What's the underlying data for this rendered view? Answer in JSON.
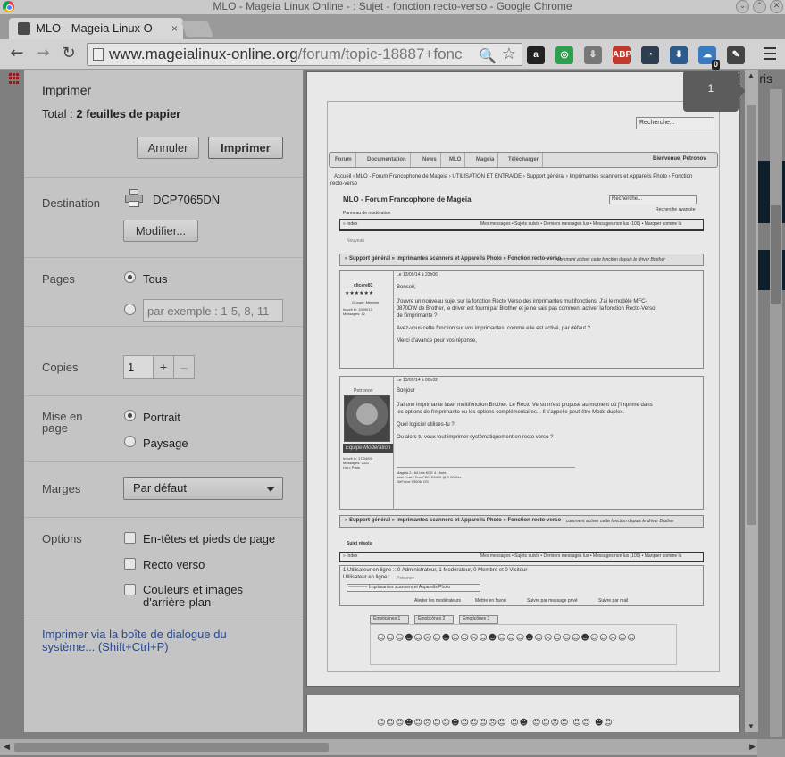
{
  "window": {
    "title": "MLO - Mageia Linux Online - : Sujet - fonction recto-verso - Google Chrome",
    "min_glyph": "⌄",
    "max_glyph": "⌃",
    "close_glyph": "✕"
  },
  "tab": {
    "title": "MLO - Mageia Linux O",
    "close_glyph": "×"
  },
  "toolbar": {
    "back_glyph": "←",
    "forward_glyph": "→",
    "reload_glyph": "↻",
    "url_host": "www.mageialinux-online.org",
    "url_path": "/forum/topic-18887+fonc",
    "zoom_glyph": "🔍",
    "star_glyph": "☆",
    "extensions": [
      {
        "name": "amazon-icon",
        "label": "a",
        "color": "#222"
      },
      {
        "name": "green-circle-icon",
        "label": "◎",
        "color": "#2e9e4f"
      },
      {
        "name": "pinned-icon",
        "label": "⇩",
        "color": "#777"
      },
      {
        "name": "adblock-icon",
        "label": "ABP",
        "color": "#c0392b"
      },
      {
        "name": "clock-icon",
        "label": "◔",
        "color": "#2c3e50"
      },
      {
        "name": "download-icon",
        "label": "⬇",
        "color": "#2c5a8a"
      },
      {
        "name": "ghostery-icon",
        "label": "☁",
        "color": "#3a7bbf",
        "badge": "0"
      },
      {
        "name": "wrench-icon",
        "label": "✎",
        "color": "#444"
      }
    ]
  },
  "background": {
    "right_text": "ris"
  },
  "print": {
    "title": "Imprimer",
    "total_prefix": "Total :",
    "total_value": "2 feuilles de papier",
    "cancel_label": "Annuler",
    "print_label": "Imprimer",
    "destination": {
      "label": "Destination",
      "printer": "DCP7065DN",
      "change_label": "Modifier..."
    },
    "pages": {
      "label": "Pages",
      "all_label": "Tous",
      "custom_placeholder": "par exemple : 1-5, 8, 11"
    },
    "copies": {
      "label": "Copies",
      "value": "1",
      "plus": "+",
      "minus": "–"
    },
    "layout": {
      "label": "Mise en page",
      "portrait": "Portrait",
      "landscape": "Paysage"
    },
    "margins": {
      "label": "Marges",
      "value": "Par défaut"
    },
    "options": {
      "label": "Options",
      "headers": "En-têtes et pieds de page",
      "duplex": "Recto verso",
      "bg": "Couleurs et images d'arrière-plan"
    },
    "system_link": "Imprimer via la boîte de dialogue du système... (Shift+Ctrl+P)",
    "page_badge": "1"
  },
  "preview": {
    "search_top": "Recherche...",
    "nav": [
      "Forum",
      "Documentation",
      "News",
      "MLO",
      "Mageia",
      "Télécharger"
    ],
    "welcome": "Bienvenue, Petronov",
    "breadcrumb": "Accueil › MLO - Forum Francophone de Mageia › UTILISATION ET ENTRAIDE › Support général › Imprimantes scanners et Appareils Photo › Fonction",
    "breadcrumb2": "recto-verso",
    "forum_title": "MLO - Forum Francophone de Mageia",
    "search_box": "Recherche...",
    "advanced": "Recherche avancée",
    "mod_panel": "Panneau de modération",
    "index": "» Index",
    "links": "Mes messages • Sujets suivis • Derniers messages lus • Messages non lus (100) • Marquer comme lu",
    "nouveau": "Nouveau",
    "topic_bar": "» Support général » Imprimantes scanners et Appareils Photo » Fonction recto-verso",
    "topic_desc": "comment activer cette fonction depuis le driver Brother",
    "post1_date": "Le 13/09/14 à 23h06",
    "post1_author": "clicere83",
    "post1_stars": "★★★★★★",
    "post1_group": "Groupe: Membre",
    "post1_meta1": "Inscrit le: 19/09/13",
    "post1_meta2": "Messages: 42",
    "post1_l1": "Bonsoir,",
    "post1_l2": "J'ouvre un nouveau sujet sur la fonction Recto Verso des imprimantes multifonctions. J'ai le modèle MFC-",
    "post1_l3": "J870DW de Brother, le driver est fourni par Brother et je ne sais pas comment activer la fonction Recto-Verso",
    "post1_l4": "de l'imprimante ?",
    "post1_l5": "Avez-vous cette fonction sur vos imprimantes, comme elle est activé, par défaut ?",
    "post1_l6": "Merci d'avance pour vos réponse,",
    "post2_date": "Le 13/09/14 à 00h02",
    "post2_author": "Petronov",
    "post2_badge": "Equipe Modération",
    "post2_meta1": "Inscrit le: 17/04/09",
    "post2_meta2": "Messages: 2311",
    "post2_meta3": "Lieu: Paris",
    "post2_l1": "Bonjour",
    "post2_l2": "J'ai une imprimante laser multifonction Brother. Le Recto Verso m'est proposé au moment où j'imprime dans",
    "post2_l3": "les options de l'imprimante ou les options complémentaires... Il s'appelle peut-être Mode duplex.",
    "post2_l4": "Quel logiciel utilises-tu ?",
    "post2_l5": "Ou alors tu veux tout imprimer systématiquement en recto verso ?",
    "post2_sig1": "Mageia 2 / 64 bits KDE 4 - bute",
    "post2_sig2": "Intel Core2 Duo CPU E8400 @ 3.00GHz",
    "post2_sig3": "GeForce 9300M GS",
    "subject_resolved": "Sujet résolu",
    "online": "1 Utilisateur en ligne :: 0 Administrateur, 1 Modérateur, 0 Membre et 0 Visiteur",
    "online2": "Utilisateur en ligne :",
    "online_user": "Petronov",
    "jump_select": "------------- Imprimantes scanners et Appareils Photo",
    "alert": "Alerter les modérateurs",
    "fav": "Mettre en favori",
    "follow": "Suivre par message privé",
    "mail": "Suivre par mail",
    "emoti_tabs": [
      "Émoticônes 1",
      "Émoticônes 2",
      "Émoticônes 3"
    ],
    "smilies_row1": "☺☺☺☻☺☹☺☻☺☺☹☺☻☺☺☺☻☺☹☺☺☺☻☺☺☹☺☺",
    "smilies_row2": "☺☺☺☻☺☹☺☺☻☺☺☺☹☺ ☺☻ ☺☺☹☺  ☺☺  ☻☺"
  }
}
